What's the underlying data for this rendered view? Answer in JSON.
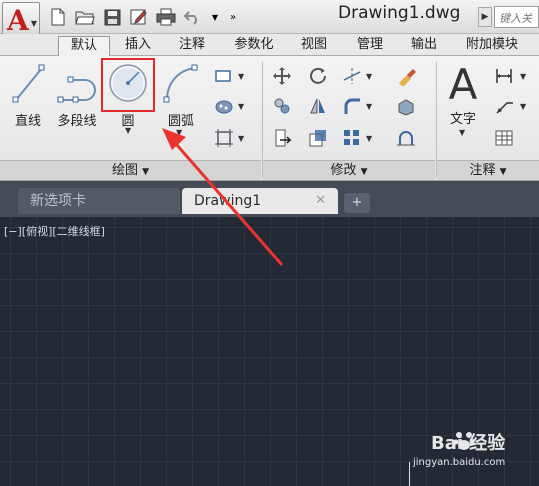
{
  "titlebar": {
    "app_icon": "A",
    "title": "Drawing1.dwg",
    "search_placeholder": "键入关",
    "qat_icons": [
      "new-file-icon",
      "open-folder-icon",
      "save-icon",
      "save-as-icon",
      "print-icon",
      "undo-icon",
      "more-icon"
    ]
  },
  "ribbon_tabs": [
    "默认",
    "插入",
    "注释",
    "参数化",
    "视图",
    "管理",
    "输出",
    "附加模块"
  ],
  "draw_panel": {
    "title": "绘图",
    "line_label": "直线",
    "polyline_label": "多段线",
    "circle_label": "圆",
    "arc_label": "圆弧"
  },
  "modify_panel": {
    "title": "修改"
  },
  "annotation_panel": {
    "title": "注释",
    "text_label": "文字",
    "text_glyph": "A"
  },
  "document_tabs": {
    "new_tab_label": "新选项卡",
    "active_tab_label": "Drawing1",
    "close_glyph": "✕",
    "add_glyph": "+"
  },
  "viewport": {
    "label": "[−][俯视][二维线框]"
  },
  "watermark": {
    "brand": "Bai  经验",
    "url": "jingyan.baidu.com"
  },
  "colors": {
    "highlight": "#e02a2a",
    "canvas": "#232a35",
    "accent": "#c0201c"
  }
}
